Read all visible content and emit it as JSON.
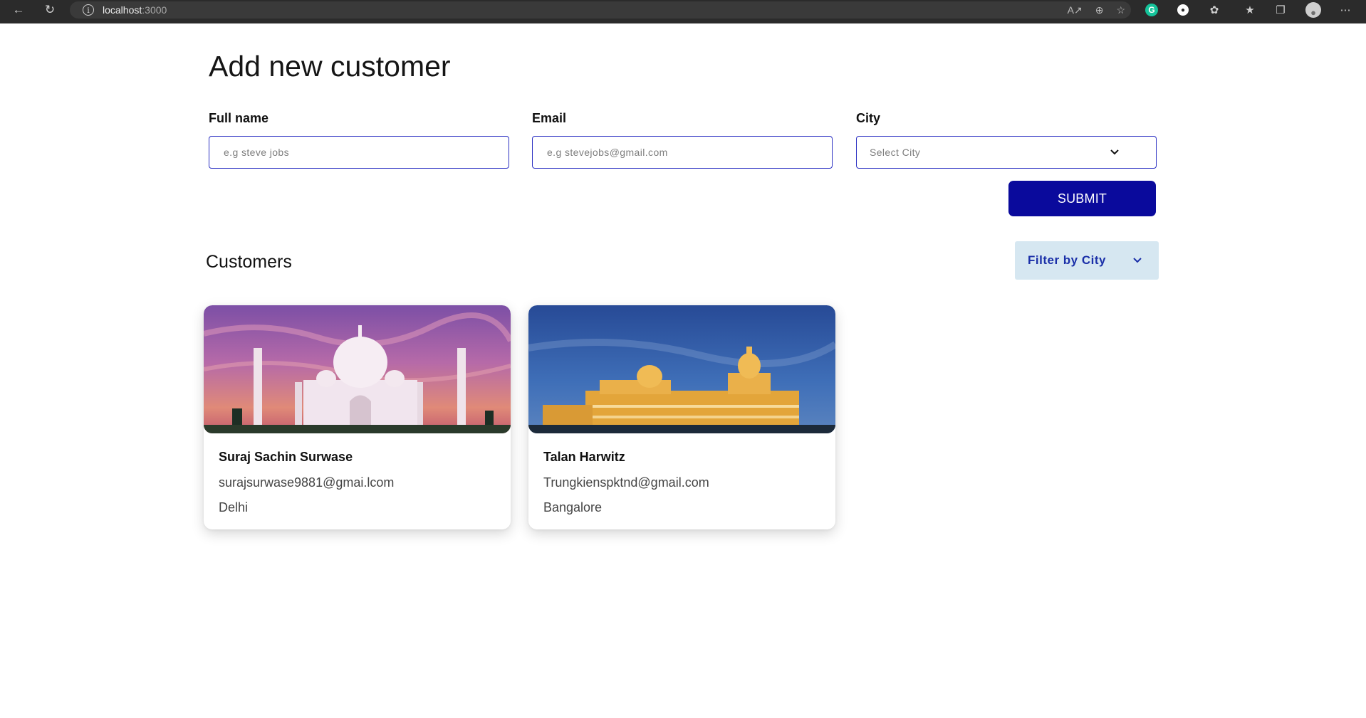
{
  "browser": {
    "url_host": "localhost",
    "url_port": ":3000"
  },
  "form": {
    "title": "Add new customer",
    "full_name": {
      "label": "Full name",
      "placeholder": "e.g steve jobs",
      "value": ""
    },
    "email": {
      "label": "Email",
      "placeholder": "e.g stevejobs@gmail.com",
      "value": ""
    },
    "city": {
      "label": "City",
      "selected": "Select City"
    },
    "submit_label": "SUBMIT"
  },
  "customers_section": {
    "title": "Customers",
    "filter_label": "Filter by City"
  },
  "customers": [
    {
      "name": "Suraj Sachin Surwase",
      "email": "surajsurwase9881@gmai.lcom",
      "city": "Delhi"
    },
    {
      "name": "Talan Harwitz",
      "email": "Trungkienspktnd@gmail.com",
      "city": "Bangalore"
    }
  ],
  "colors": {
    "primary": "#0a0a9c",
    "input_border": "#2a2fc2",
    "filter_bg": "#d6e7f1",
    "filter_text": "#1a2fa8"
  },
  "icons": [
    "back-arrow-icon",
    "refresh-icon",
    "info-icon",
    "read-aloud-icon",
    "zoom-icon",
    "favorite-icon",
    "grammarly-icon",
    "extension-icon",
    "puzzle-icon",
    "favorites-list-icon",
    "collections-icon",
    "profile-icon",
    "more-icon",
    "chevron-down-icon"
  ]
}
